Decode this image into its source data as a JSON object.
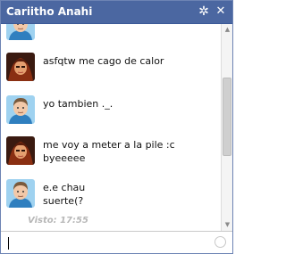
{
  "window": {
    "title": "Cariitho Anahi",
    "gear_icon": "gear-icon",
    "close_icon": "close-icon",
    "title_bar_color": "#4b67a1"
  },
  "messages": [
    {
      "sender": "self",
      "lines": []
    },
    {
      "sender": "contact",
      "lines": [
        "asfqtw me cago de calor"
      ]
    },
    {
      "sender": "self",
      "lines": [
        "yo tambien ._."
      ]
    },
    {
      "sender": "contact",
      "lines": [
        "me voy a meter a la pile :c",
        "byeeeee"
      ]
    },
    {
      "sender": "self",
      "lines": [
        "e.e chau",
        "suerte(?"
      ]
    }
  ],
  "seen_status": "Visto: 17:55",
  "composer": {
    "value": "",
    "emoticon_icon": "smiley-icon"
  }
}
